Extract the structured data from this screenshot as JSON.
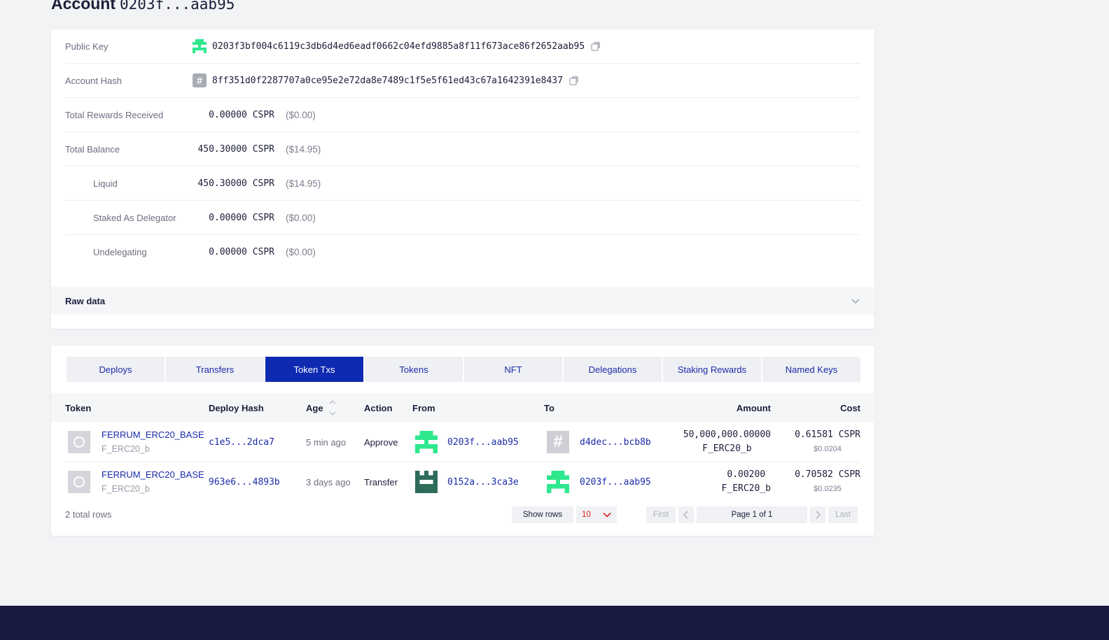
{
  "header": {
    "title": "Account",
    "account_short": "0203f...aab95"
  },
  "account": {
    "rows": [
      {
        "label": "Public Key",
        "value": "0203f3bf004c6119c3db6d4ed6eadf0662c04efd9885a8f11f673ace86f2652aab95"
      },
      {
        "label": "Account Hash",
        "value": "8ff351d0f2287707a0ce95e2e72da8e7489c1f5e5f61ed43c67a1642391e8437"
      },
      {
        "label": "Total Rewards Received",
        "amount": "0.00000 CSPR",
        "usd": "($0.00)"
      },
      {
        "label": "Total Balance",
        "amount": "450.30000 CSPR",
        "usd": "($14.95)"
      },
      {
        "label": "Liquid",
        "amount": "450.30000 CSPR",
        "usd": "($14.95)"
      },
      {
        "label": "Staked As Delegator",
        "amount": "0.00000 CSPR",
        "usd": "($0.00)"
      },
      {
        "label": "Undelegating",
        "amount": "0.00000 CSPR",
        "usd": "($0.00)"
      }
    ],
    "raw_data_label": "Raw data",
    "hash_glyph": "#"
  },
  "tabs": [
    {
      "label": "Deploys"
    },
    {
      "label": "Transfers"
    },
    {
      "label": "Token Txs",
      "active": true
    },
    {
      "label": "Tokens"
    },
    {
      "label": "NFT"
    },
    {
      "label": "Delegations"
    },
    {
      "label": "Staking Rewards"
    },
    {
      "label": "Named Keys"
    }
  ],
  "table": {
    "columns": [
      "Token",
      "Deploy Hash",
      "Age",
      "Action",
      "From",
      "To",
      "Amount",
      "Cost"
    ],
    "rows": [
      {
        "token_name": "FERRUM_ERC20_BASE",
        "token_symbol": "F_ERC20_b",
        "deploy_hash": "c1e5...2dca7",
        "age": "5 min ago",
        "action": "Approve",
        "from": "0203f...aab95",
        "to": "d4dec...bcb8b",
        "amount": "50,000,000.00000",
        "amount_symbol": "F_ERC20_b",
        "cost": "0.61581 CSPR",
        "cost_usd": "$0.0204"
      },
      {
        "token_name": "FERRUM_ERC20_BASE",
        "token_symbol": "F_ERC20_b",
        "deploy_hash": "963e6...4893b",
        "age": "3 days ago",
        "action": "Transfer",
        "from": "0152a...3ca3e",
        "to": "0203f...aab95",
        "amount": "0.00200",
        "amount_symbol": "F_ERC20_b",
        "cost": "0.70582 CSPR",
        "cost_usd": "$0.0235"
      }
    ],
    "total_rows": "2 total rows"
  },
  "pagination": {
    "show_rows_label": "Show rows",
    "rows_per_page": "10",
    "first": "First",
    "page_info": "Page 1 of 1",
    "last": "Last"
  },
  "colors": {
    "accent": "#0e2ab0",
    "link": "#1b2ba8",
    "avatar_green": "#2ee88e",
    "avatar_dark_green": "#2e6b5b",
    "footer": "#181b3f"
  }
}
